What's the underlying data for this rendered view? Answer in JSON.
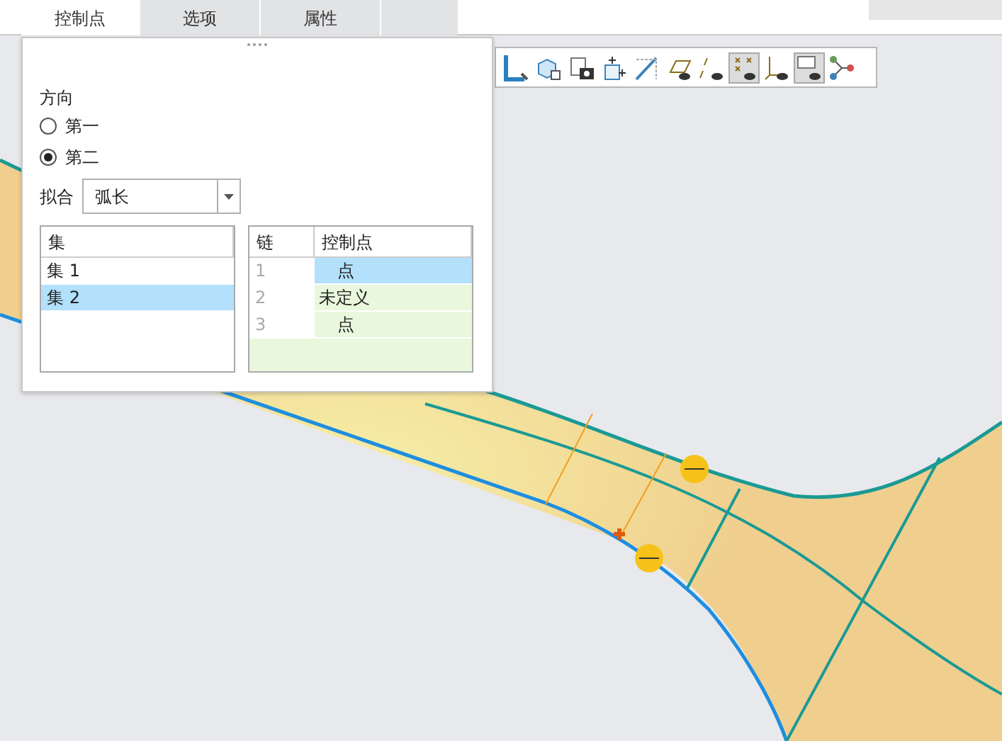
{
  "tabs": [
    {
      "label": "控制点",
      "selected": true
    },
    {
      "label": "选项",
      "selected": false
    },
    {
      "label": "属性",
      "selected": false
    }
  ],
  "toolbar": [
    {
      "kind": "edge",
      "pressed": false
    },
    {
      "kind": "cube-view",
      "pressed": false
    },
    {
      "kind": "camera",
      "pressed": false
    },
    {
      "kind": "cube-add",
      "pressed": false
    },
    {
      "kind": "plane",
      "pressed": false
    },
    {
      "kind": "plane-eye",
      "pressed": false
    },
    {
      "kind": "axis-eye",
      "pressed": false
    },
    {
      "kind": "points-eye",
      "pressed": true
    },
    {
      "kind": "csys-eye",
      "pressed": false
    },
    {
      "kind": "note-eye",
      "pressed": true
    },
    {
      "kind": "graph",
      "pressed": false
    }
  ],
  "panel": {
    "direction_label": "方向",
    "direction_options": [
      {
        "label": "第一",
        "selected": false
      },
      {
        "label": "第二",
        "selected": true
      }
    ],
    "fit": {
      "label": "拟合",
      "value": "弧长"
    },
    "sets_table": {
      "columns": [
        "集"
      ],
      "rows": [
        {
          "label": "集 1",
          "selected": false
        },
        {
          "label": "集 2",
          "selected": true
        }
      ]
    },
    "points_table": {
      "columns": [
        "链",
        "控制点"
      ],
      "rows": [
        {
          "chain": "1",
          "point": "点",
          "selected": true,
          "defined": true
        },
        {
          "chain": "2",
          "point": "未定义",
          "selected": false,
          "defined": false
        },
        {
          "chain": "3",
          "point": "点",
          "selected": false,
          "defined": true
        }
      ]
    }
  }
}
